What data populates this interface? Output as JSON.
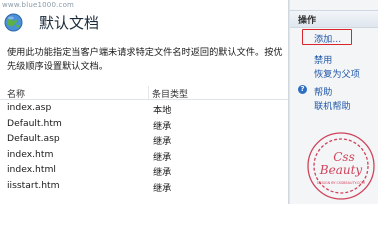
{
  "watermark": {
    "url": "www.blue1000.com"
  },
  "page": {
    "title": "默认文档",
    "description": "使用此功能指定当客户端未请求特定文件名时返回的默认文件。按优先级顺序设置默认文档。"
  },
  "table": {
    "columns": {
      "name": "名称",
      "type": "条目类型"
    },
    "rows": [
      {
        "name": "index.asp",
        "type": "本地"
      },
      {
        "name": "Default.htm",
        "type": "继承"
      },
      {
        "name": "Default.asp",
        "type": "继承"
      },
      {
        "name": "index.htm",
        "type": "继承"
      },
      {
        "name": "index.html",
        "type": "继承"
      },
      {
        "name": "iisstart.htm",
        "type": "继承"
      }
    ]
  },
  "actions": {
    "header": "操作",
    "add": "添加...",
    "disable": "禁用",
    "revert": "恢复为父项",
    "help": "帮助",
    "online_help": "联机帮助"
  },
  "stamp": {
    "line1": "Css",
    "line2": "Beauty",
    "line3": "DESIGN BY CSSBEAUTY.COM"
  },
  "colors": {
    "link": "#1f57a8",
    "highlight_box": "#d9262b",
    "stamp": "#c9243f"
  }
}
